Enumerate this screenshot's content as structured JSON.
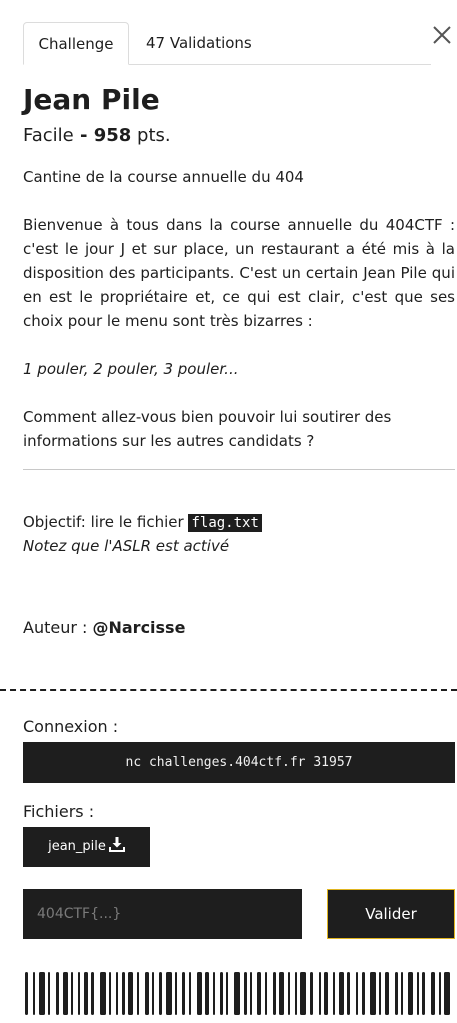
{
  "tabs": {
    "challenge": "Challenge",
    "validations": "47 Validations"
  },
  "challenge": {
    "name": "Jean Pile",
    "difficulty": "Facile",
    "separator": " - ",
    "points": "958",
    "points_unit": " pts.",
    "short_description": "Cantine de la course annuelle du 404",
    "paragraph1": "Bienvenue à tous dans la course annuelle du 404CTF : c'est le jour J et sur place, un restaurant a été mis à la disposition des participants. C'est un certain Jean Pile qui en est le propriétaire et, ce qui est clair, c'est que ses choix pour le menu sont très bizarres :",
    "italic_line": "1 pouler, 2 pouler, 3 pouler...",
    "paragraph2": "Comment allez-vous bien pouvoir lui soutirer des informations sur les autres candidats ?",
    "objective_prefix": "Objectif: lire le fichier ",
    "objective_file": "flag.txt",
    "aslr_note": "Notez que l'ASLR est activé",
    "author_label": "Auteur : ",
    "author_name": "@Narcisse"
  },
  "connection": {
    "label": "Connexion :",
    "command": "nc challenges.404ctf.fr 31957"
  },
  "files": {
    "label": "Fichiers :",
    "items": [
      {
        "name": "jean_pile",
        "icon": "download-icon"
      }
    ]
  },
  "submit": {
    "placeholder": "404CTF{...}",
    "button_label": "Valider"
  },
  "colors": {
    "dark": "#1e1e1e",
    "accent_border": "#e0b520",
    "separator": "#c8c8c8"
  },
  "icons": {
    "close": "close-icon",
    "download": "download-icon",
    "barcode": "barcode-decoration"
  }
}
